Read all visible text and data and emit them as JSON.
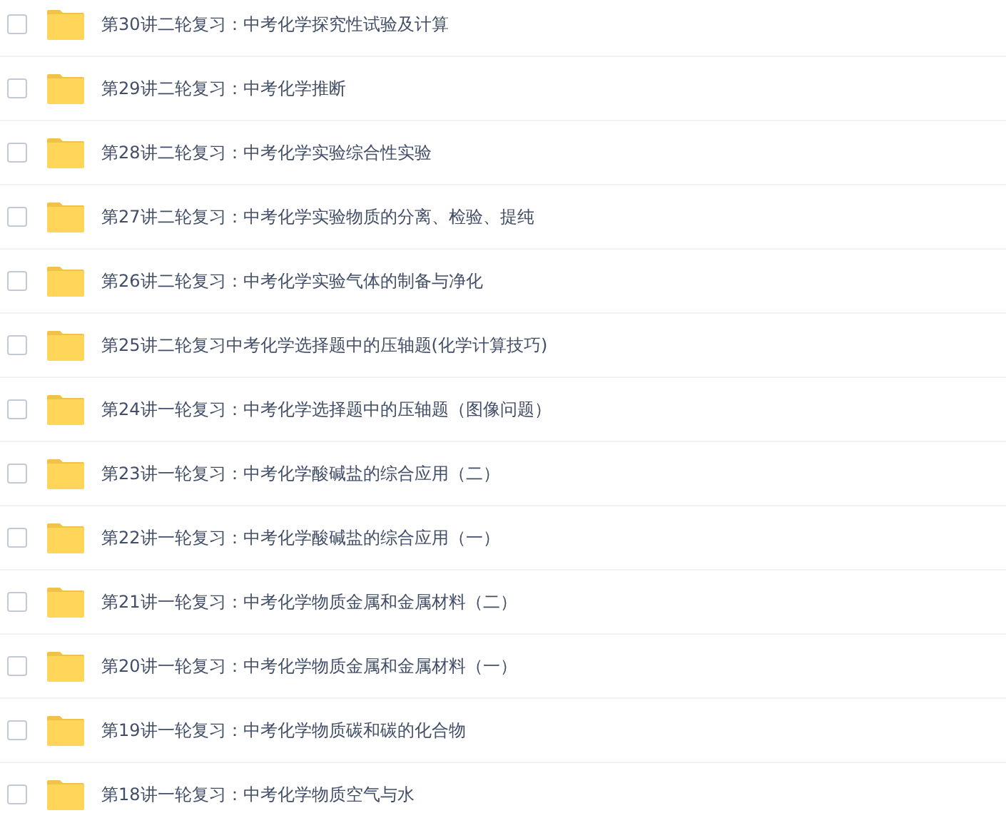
{
  "files": [
    {
      "name": "第30讲二轮复习：中考化学探究性试验及计算",
      "checked": false
    },
    {
      "name": "第29讲二轮复习：中考化学推断",
      "checked": false
    },
    {
      "name": "第28讲二轮复习：中考化学实验综合性实验",
      "checked": false
    },
    {
      "name": "第27讲二轮复习：中考化学实验物质的分离、检验、提纯",
      "checked": false
    },
    {
      "name": "第26讲二轮复习：中考化学实验气体的制备与净化",
      "checked": false
    },
    {
      "name": "第25讲二轮复习中考化学选择题中的压轴题(化学计算技巧)",
      "checked": false
    },
    {
      "name": "第24讲一轮复习：中考化学选择题中的压轴题（图像问题）",
      "checked": false
    },
    {
      "name": "第23讲一轮复习：中考化学酸碱盐的综合应用（二）",
      "checked": false
    },
    {
      "name": "第22讲一轮复习：中考化学酸碱盐的综合应用（一）",
      "checked": false
    },
    {
      "name": "第21讲一轮复习：中考化学物质金属和金属材料（二）",
      "checked": false
    },
    {
      "name": "第20讲一轮复习：中考化学物质金属和金属材料（一）",
      "checked": false
    },
    {
      "name": "第19讲一轮复习：中考化学物质碳和碳的化合物",
      "checked": false
    },
    {
      "name": "第18讲一轮复习：中考化学物质空气与水",
      "checked": false
    }
  ]
}
